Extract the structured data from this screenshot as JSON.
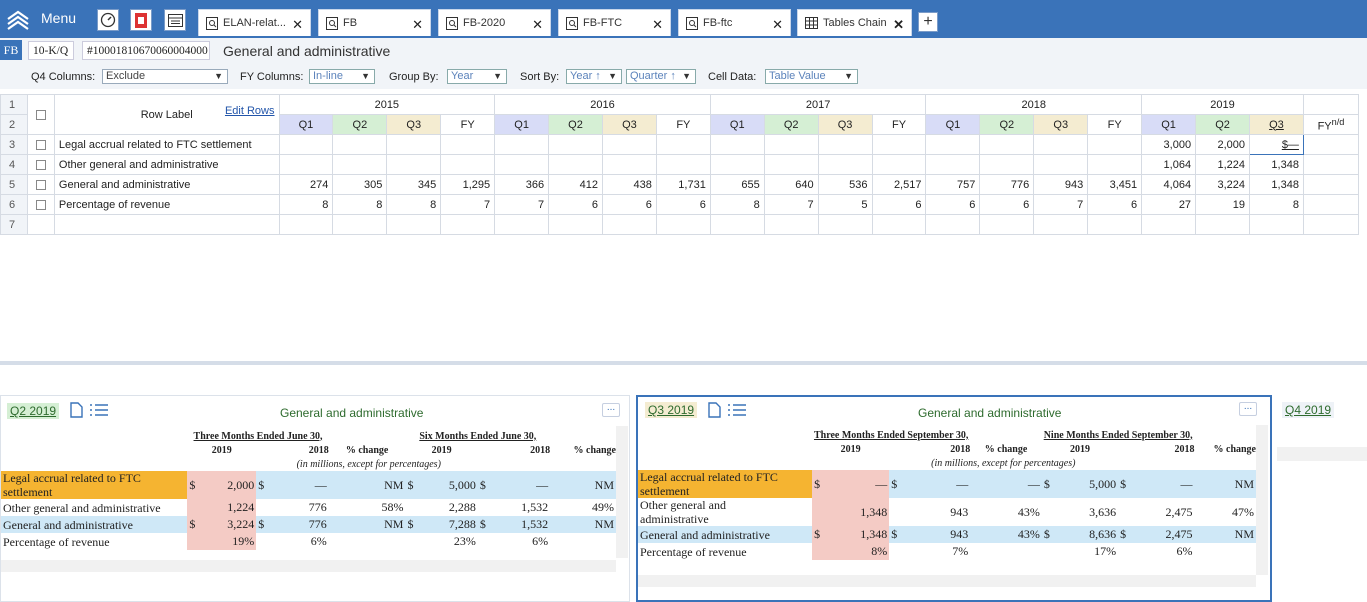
{
  "app": {
    "menu_label": "Menu"
  },
  "tabs": [
    {
      "label": "ELAN-relat..."
    },
    {
      "label": "FB"
    },
    {
      "label": "FB-2020"
    },
    {
      "label": "FB-FTC"
    },
    {
      "label": "FB-ftc"
    },
    {
      "label": "Tables Chain"
    }
  ],
  "header": {
    "ticker": "FB",
    "form": "10-K/Q",
    "id": "#10001810670060004000",
    "title": "General and administrative"
  },
  "controls": {
    "q4_label": "Q4 Columns:",
    "q4_value": "Exclude",
    "fy_label": "FY Columns:",
    "fy_value": "In-line",
    "group_label": "Group By:",
    "group_value": "Year",
    "sort_label": "Sort By:",
    "sort_value1": "Year ↑",
    "sort_value2": "Quarter ↑",
    "cell_label": "Cell Data:",
    "cell_value": "Table Value"
  },
  "grid": {
    "row_label_header": "Row Label",
    "edit_rows": "Edit Rows",
    "years": [
      "2015",
      "2016",
      "2017",
      "2018",
      "2019"
    ],
    "quarters": [
      "Q1",
      "Q2",
      "Q3",
      "FY"
    ],
    "extra_header": "FY",
    "extra_sup": "n/d",
    "row_numbers": [
      "1",
      "2",
      "3",
      "4",
      "5",
      "6",
      "7"
    ],
    "rows": [
      {
        "label": "Legal accrual related to FTC settlement",
        "values": [
          "",
          "",
          "",
          "",
          "",
          "",
          "",
          "",
          "",
          "",
          "",
          "",
          "",
          "",
          "",
          "",
          "3,000",
          "2,000",
          "$—"
        ]
      },
      {
        "label": "Other general and administrative",
        "values": [
          "",
          "",
          "",
          "",
          "",
          "",
          "",
          "",
          "",
          "",
          "",
          "",
          "",
          "",
          "",
          "",
          "1,064",
          "1,224",
          "1,348"
        ]
      },
      {
        "label": "General and administrative",
        "values": [
          "274",
          "305",
          "345",
          "1,295",
          "366",
          "412",
          "438",
          "1,731",
          "655",
          "640",
          "536",
          "2,517",
          "757",
          "776",
          "943",
          "3,451",
          "4,064",
          "3,224",
          "1,348"
        ]
      },
      {
        "label": "Percentage of revenue",
        "values": [
          "8",
          "8",
          "8",
          "7",
          "7",
          "6",
          "6",
          "6",
          "8",
          "7",
          "5",
          "6",
          "6",
          "6",
          "7",
          "6",
          "27",
          "19",
          "8"
        ]
      }
    ]
  },
  "left_panel": {
    "period": "Q2 2019",
    "title": "General and administrative",
    "h1": "Three Months Ended June 30,",
    "h2": "Six Months Ended June 30,",
    "y2019": "2019",
    "y2018": "2018",
    "pct_change": "% change",
    "note": "(in millions, except for percentages)",
    "rows": [
      {
        "label1": "Legal accrual related to FTC",
        "label2": "settlement",
        "d1": "$",
        "v1": "2,000",
        "d2": "$",
        "v2": "—",
        "c1": "NM",
        "d3": "$",
        "v3": "5,000",
        "d4": "$",
        "v4": "—",
        "c2": "NM"
      },
      {
        "label1": "Other general and administrative",
        "v1": "1,224",
        "v2": "776",
        "c1": "58%",
        "v3": "2,288",
        "v4": "1,532",
        "c2": "49%"
      },
      {
        "label1": "General and administrative",
        "d1": "$",
        "v1": "3,224",
        "d2": "$",
        "v2": "776",
        "c1": "NM",
        "d3": "$",
        "v3": "7,288",
        "d4": "$",
        "v4": "1,532",
        "c2": "NM"
      },
      {
        "label1": "Percentage of revenue",
        "v1": "19%",
        "v2": "6%",
        "v3": "23%",
        "v4": "6%"
      }
    ]
  },
  "right_panel": {
    "period": "Q3 2019",
    "title": "General and administrative",
    "h1": "Three Months Ended September 30,",
    "h2": "Nine Months Ended September 30,",
    "y2019": "2019",
    "y2018": "2018",
    "pct_change": "% change",
    "note": "(in millions, except for percentages)",
    "rows": [
      {
        "label1": "Legal accrual related to FTC",
        "label2": "settlement",
        "d1": "$",
        "v1": "—",
        "d2": "$",
        "v2": "—",
        "c1": "—",
        "d3": "$",
        "v3": "5,000",
        "d4": "$",
        "v4": "—",
        "c2": "NM"
      },
      {
        "label1": "Other general and",
        "label2": "administrative",
        "v1": "1,348",
        "v2": "943",
        "c1": "43%",
        "v3": "3,636",
        "v4": "2,475",
        "c2": "47%"
      },
      {
        "label1": "General and administrative",
        "d1": "$",
        "v1": "1,348",
        "d2": "$",
        "v2": "943",
        "c1": "43%",
        "d3": "$",
        "v3": "8,636",
        "d4": "$",
        "v4": "2,475",
        "c2": "NM"
      },
      {
        "label1": "Percentage of revenue",
        "v1": "8%",
        "v2": "7%",
        "v3": "17%",
        "v4": "6%"
      }
    ]
  },
  "q4_panel": {
    "period": "Q4 2019"
  },
  "colors": {
    "brand": "#3a73b9",
    "q1": "#d8dcf7",
    "q2": "#d5efd4",
    "q3": "#f4ecd1",
    "highlight_orange": "#f5b431",
    "highlight_blue": "#cfe8f7",
    "highlight_pink": "#f4cbc5"
  }
}
